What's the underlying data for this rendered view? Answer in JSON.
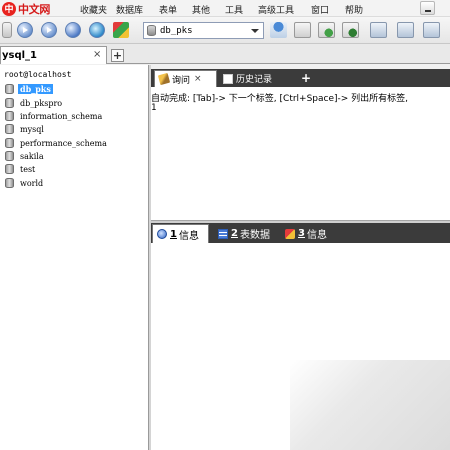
{
  "logo": {
    "badge": "中",
    "text": "中文网"
  },
  "menu": {
    "items": [
      "收藏夹",
      "数据库",
      "表单",
      "其他",
      "工具",
      "高级工具",
      "窗口",
      "帮助"
    ]
  },
  "toolbar": {
    "database_select": "db_pks"
  },
  "connection": {
    "tab_label": "ysql_1",
    "close_glyph": "×",
    "add_glyph": "+"
  },
  "tree": {
    "root": "root@localhost",
    "items": [
      "db_pks",
      "db_pkspro",
      "information_schema",
      "mysql",
      "performance_schema",
      "sakila",
      "test",
      "world"
    ],
    "selected": "db_pks"
  },
  "query_tabs": {
    "query_label": "询问",
    "history_label": "历史记录",
    "close_glyph": "×",
    "add_glyph": "+"
  },
  "editor": {
    "hint": "自动完成: [Tab]-> 下一个标签, [Ctrl+Space]-> 列出所有标签,",
    "line_number": "1"
  },
  "result_tabs": [
    {
      "num": "1",
      "label": "信息"
    },
    {
      "num": "2",
      "label": "表数据"
    },
    {
      "num": "3",
      "label": "信息"
    }
  ],
  "colors": {
    "selection": "#3399ff",
    "tab_strip": "#3b3b3b",
    "logo_red": "#d51a1a"
  }
}
